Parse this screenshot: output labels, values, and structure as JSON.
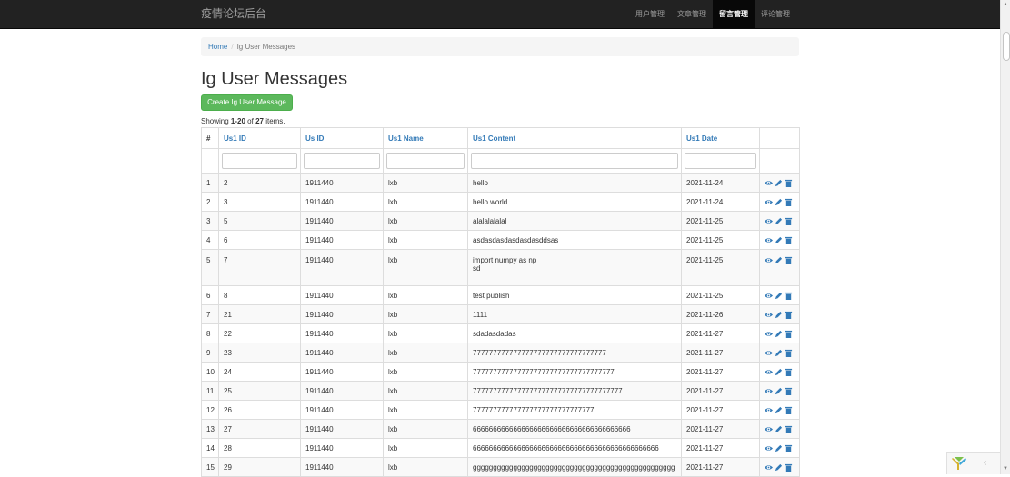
{
  "navbar": {
    "brand": "疫情论坛后台",
    "items": [
      {
        "label": "用户管理",
        "active": false
      },
      {
        "label": "文章管理",
        "active": false
      },
      {
        "label": "留言管理",
        "active": true
      },
      {
        "label": "评论管理",
        "active": false
      }
    ]
  },
  "breadcrumb": {
    "home": "Home",
    "separator": "/",
    "current": "Ig User Messages"
  },
  "page": {
    "title": "Ig User Messages",
    "create_label": "Create Ig User Message",
    "summary_prefix": "Showing ",
    "summary_range": "1-20",
    "summary_mid": " of ",
    "summary_total": "27",
    "summary_suffix": " items."
  },
  "table": {
    "headers": [
      "#",
      "Us1 ID",
      "Us ID",
      "Us1 Name",
      "Us1 Content",
      "Us1 Date"
    ],
    "rows": [
      {
        "n": "1",
        "id": "2",
        "us": "1911440",
        "name": "lxb",
        "content": "hello",
        "date": "2021-11-24"
      },
      {
        "n": "2",
        "id": "3",
        "us": "1911440",
        "name": "lxb",
        "content": "hello world",
        "date": "2021-11-24"
      },
      {
        "n": "3",
        "id": "5",
        "us": "1911440",
        "name": "lxb",
        "content": "alalalalalal",
        "date": "2021-11-25"
      },
      {
        "n": "4",
        "id": "6",
        "us": "1911440",
        "name": "lxb",
        "content": "asdasdasdasdasdasddsas",
        "date": "2021-11-25"
      },
      {
        "n": "5",
        "id": "7",
        "us": "1911440",
        "name": "lxb",
        "content": "import numpy as np\nsd",
        "date": "2021-11-25"
      },
      {
        "n": "6",
        "id": "8",
        "us": "1911440",
        "name": "lxb",
        "content": "test publish",
        "date": "2021-11-25"
      },
      {
        "n": "7",
        "id": "21",
        "us": "1911440",
        "name": "lxb",
        "content": "1111",
        "date": "2021-11-26"
      },
      {
        "n": "8",
        "id": "22",
        "us": "1911440",
        "name": "lxb",
        "content": "sdadasdadas",
        "date": "2021-11-27"
      },
      {
        "n": "9",
        "id": "23",
        "us": "1911440",
        "name": "lxb",
        "content": "777777777777777777777777777777777",
        "date": "2021-11-27"
      },
      {
        "n": "10",
        "id": "24",
        "us": "1911440",
        "name": "lxb",
        "content": "77777777777777777777777777777777777",
        "date": "2021-11-27"
      },
      {
        "n": "11",
        "id": "25",
        "us": "1911440",
        "name": "lxb",
        "content": "7777777777777777777777777777777777777",
        "date": "2021-11-27"
      },
      {
        "n": "12",
        "id": "26",
        "us": "1911440",
        "name": "lxb",
        "content": "777777777777777777777777777777",
        "date": "2021-11-27"
      },
      {
        "n": "13",
        "id": "27",
        "us": "1911440",
        "name": "lxb",
        "content": "666666666666666666666666666666666666666",
        "date": "2021-11-27"
      },
      {
        "n": "14",
        "id": "28",
        "us": "1911440",
        "name": "lxb",
        "content": "6666666666666666666666666666666666666666666666",
        "date": "2021-11-27"
      },
      {
        "n": "15",
        "id": "29",
        "us": "1911440",
        "name": "lxb",
        "content": "gggggggggggggggggggggggggggggggggggggggggggggggggg",
        "date": "2021-11-27"
      }
    ]
  },
  "icons": {
    "view": "eye-icon",
    "edit": "pencil-icon",
    "delete": "trash-icon"
  },
  "colors": {
    "navbar": "#222222",
    "link": "#337ab7",
    "create": "#5cb85c"
  }
}
